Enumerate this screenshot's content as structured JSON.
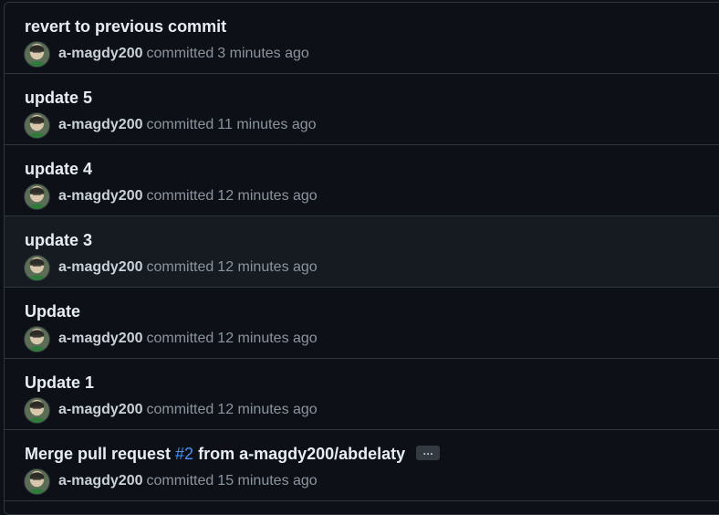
{
  "commits": [
    {
      "title": "revert to previous commit",
      "author": "a-magdy200",
      "action": "committed",
      "time": "3 minutes ago"
    },
    {
      "title": "update 5",
      "author": "a-magdy200",
      "action": "committed",
      "time": "11 minutes ago"
    },
    {
      "title": "update 4",
      "author": "a-magdy200",
      "action": "committed",
      "time": "12 minutes ago"
    },
    {
      "title": "update 3",
      "author": "a-magdy200",
      "action": "committed",
      "time": "12 minutes ago"
    },
    {
      "title": "Update",
      "author": "a-magdy200",
      "action": "committed",
      "time": "12 minutes ago"
    },
    {
      "title": "Update 1",
      "author": "a-magdy200",
      "action": "committed",
      "time": "12 minutes ago"
    },
    {
      "title_prefix": "Merge pull request ",
      "pr": "#2",
      "title_suffix": " from a-magdy200/abdelaty",
      "expand_label": "…",
      "author": "a-magdy200",
      "action": "committed",
      "time": "15 minutes ago"
    }
  ],
  "colors": {
    "background": "#0d1117",
    "row_highlight": "#161b22",
    "border": "#30363d",
    "text": "#e6edf3",
    "muted": "#8b949e",
    "link": "#4493f8"
  }
}
